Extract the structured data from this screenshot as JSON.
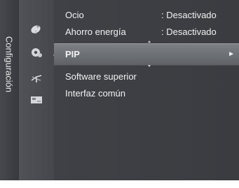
{
  "side_tab": {
    "label": "Configuración"
  },
  "icons": [
    "satellite-dish-icon",
    "gear-settings-icon",
    "antenna-icon",
    "input-card-icon"
  ],
  "menu": {
    "items": [
      {
        "label": "Ocio",
        "value": ": Desactivado"
      },
      {
        "label": "Ahorro energía",
        "value": ": Desactivado"
      },
      {
        "label": "PIP",
        "value": "",
        "arrow": "►"
      },
      {
        "label": "Software superior",
        "value": ""
      },
      {
        "label": "Interfaz común",
        "value": ""
      }
    ],
    "selected_index": 2
  },
  "colors": {
    "background": "#3a3c41",
    "highlight": "#7d8085",
    "text": "#f2f2f2"
  }
}
